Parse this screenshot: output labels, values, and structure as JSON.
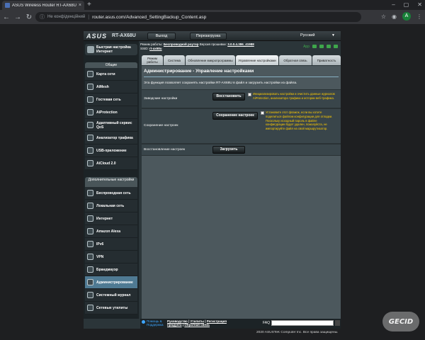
{
  "browser": {
    "tab_title": "ASUS Wireless Router RT-AX68U",
    "tab_close": "×",
    "new_tab": "+",
    "win_min": "–",
    "win_max": "▢",
    "win_close": "✕",
    "back": "←",
    "forward": "→",
    "reload": "↻",
    "security_icon": "ⓘ",
    "security_text": "Не конфіденційний",
    "separator": "|",
    "url": "router.asus.com/Advanced_SettingBackup_Content.asp",
    "star": "☆",
    "ext": "◉",
    "profile": "A",
    "menu": "⋮"
  },
  "router": {
    "logo": "ASUS",
    "model": "RT-AX68U",
    "logout": "Выход",
    "reboot": "Перезагрузка",
    "language": "Русский",
    "lang_arrow": "▼",
    "status": {
      "mode_label": "Режим работы:",
      "mode_value": "Беспроводной роутер",
      "fw_label": "Версия прошивки:",
      "fw_value": "3.0.0.4.386_41988",
      "ssid_label": "SSID:",
      "ssid_value": "rt-ax68u",
      "app_label": "App"
    },
    "quick_internet": "Быстрая настройка Интернет",
    "general_head": "Общие",
    "general_items": [
      {
        "label": "Карта сети"
      },
      {
        "label": "AiMesh"
      },
      {
        "label": "Гостевая сеть"
      },
      {
        "label": "AiProtection"
      },
      {
        "label": "Адаптивный сервис QoS"
      },
      {
        "label": "Анализатор трафика"
      },
      {
        "label": "USB-приложение"
      },
      {
        "label": "AiCloud 2.0"
      }
    ],
    "advanced_head": "Дополнительные настройки",
    "advanced_items": [
      {
        "label": "Беспроводная сеть"
      },
      {
        "label": "Локальная сеть"
      },
      {
        "label": "Интернет"
      },
      {
        "label": "Amazon Alexa"
      },
      {
        "label": "IPv6"
      },
      {
        "label": "VPN"
      },
      {
        "label": "Брандмауэр"
      },
      {
        "label": "Администрирование"
      },
      {
        "label": "Системный журнал"
      },
      {
        "label": "Сетевые утилиты"
      }
    ],
    "tabs": [
      {
        "label": "Режим работы"
      },
      {
        "label": "Система"
      },
      {
        "label": "Обновление микропрограммы"
      },
      {
        "label": "Управление настройками"
      },
      {
        "label": "Обратная связь"
      },
      {
        "label": "Приватность"
      }
    ],
    "panel": {
      "title": "Администрирование - Управление настройками",
      "description": "Эта функция позволяет сохранять настройки RT-AX68U в файл и загрузить настройки из файла.",
      "rows": [
        {
          "label": "Заводские настройки",
          "button": "Восстановить",
          "note": "Инициализировать настройки и очистить данные журналов AiProtection, анализатора трафика и истории веб-трафика."
        },
        {
          "label": "Сохранение настроек",
          "button": "Сохранение настроек",
          "note": "Установите этот флажок, если вы хотите поделиться файлом конфигурации для отладки. Поскольку исходный пароль в файле конфигурации будет удален, пожалуйста, не импортируйте файл на свой маршрутизатор."
        },
        {
          "label": "Восстановление настроек",
          "button": "Загрузить",
          "note": ""
        }
      ]
    },
    "footer": {
      "help_line1": "Помощь &",
      "help_line2": "Поддержка",
      "links_line1_a": "Руководство",
      "links_line1_sep1": " | ",
      "links_line1_b": "Утилиты",
      "links_line1_sep2": " | ",
      "links_line1_c": "Регистрация",
      "links_line2_a": "продукта",
      "links_line2_sep": " | ",
      "links_line2_b": "Обратная связь",
      "faq": "FAQ"
    },
    "copyright": "2020 ASUSTeK Computer Inc. Все права защищены."
  },
  "watermark": "GECID"
}
